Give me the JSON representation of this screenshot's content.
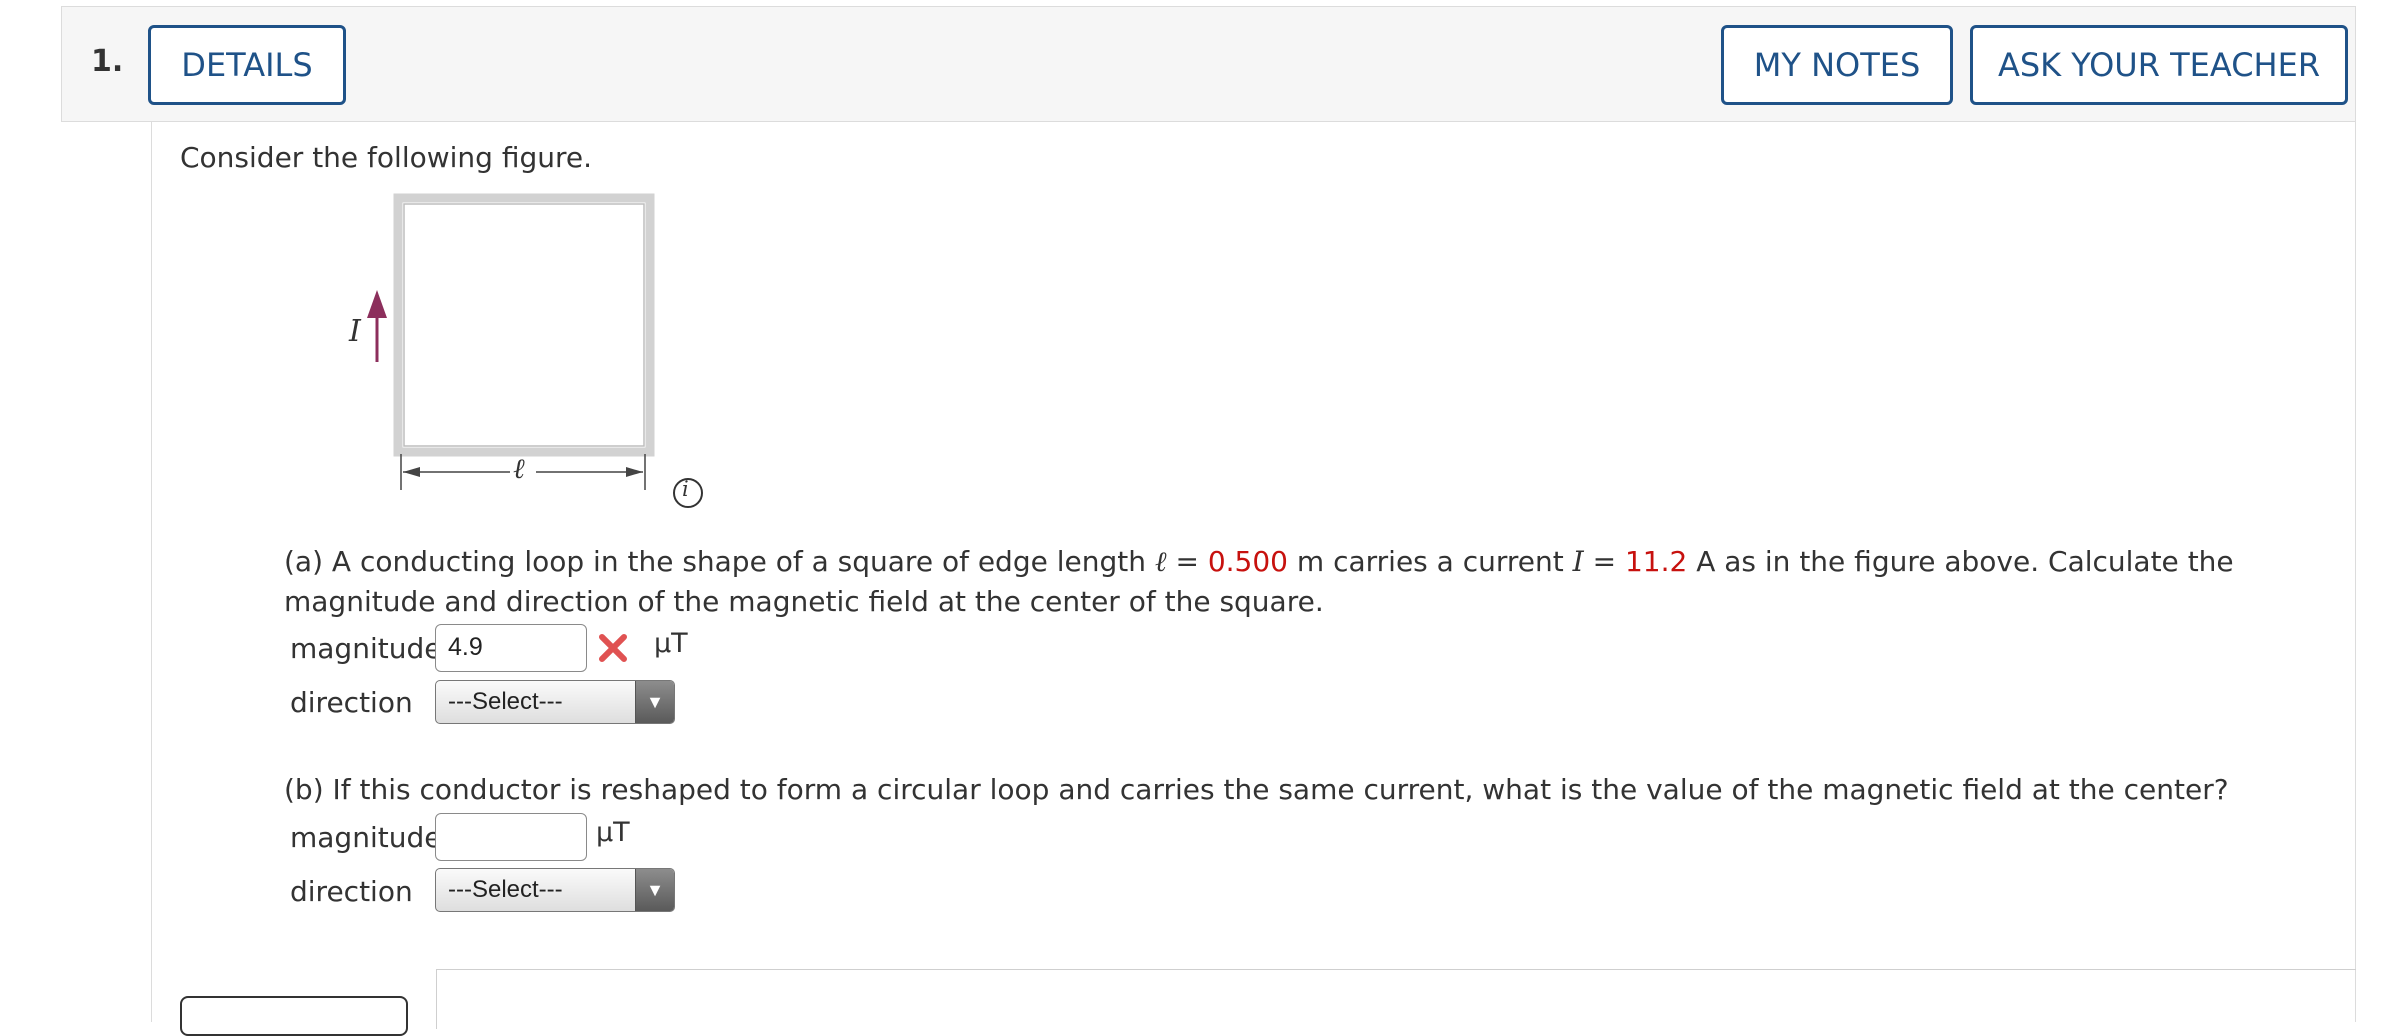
{
  "header": {
    "question_number": "1.",
    "details_label": "DETAILS",
    "my_notes_label": "MY NOTES",
    "ask_teacher_label": "ASK YOUR TEACHER"
  },
  "intro": "Consider the following figure.",
  "figure": {
    "current_label": "I",
    "length_label": "ℓ",
    "info_icon": "info-icon"
  },
  "part_a": {
    "text_1": "(a) A conducting loop in the shape of a square of edge length ",
    "ell": "ℓ",
    "eq_1": " = ",
    "length_value": "0.500",
    "text_2": " m carries a current ",
    "current_symbol": "I",
    "eq_2": " = ",
    "current_value": "11.2",
    "text_3": " A as in the figure above. Calculate the magnitude and direction of the magnetic field at the center of the square.",
    "magnitude_label": "magnitude",
    "magnitude_value": "4.9",
    "magnitude_unit": "μT",
    "direction_label": "direction",
    "direction_selected": "---Select---",
    "status": "incorrect"
  },
  "part_b": {
    "text": "(b) If this conductor is reshaped to form a circular loop and carries the same current, what is the value of the magnetic field at the center?",
    "magnitude_label": "magnitude",
    "magnitude_value": "",
    "magnitude_unit": "μT",
    "direction_label": "direction",
    "direction_selected": "---Select---"
  },
  "colors": {
    "accent": "#1f5288",
    "given_value": "#c7110e",
    "arrow": "#8c2f5c",
    "incorrect_mark": "#e05252"
  }
}
